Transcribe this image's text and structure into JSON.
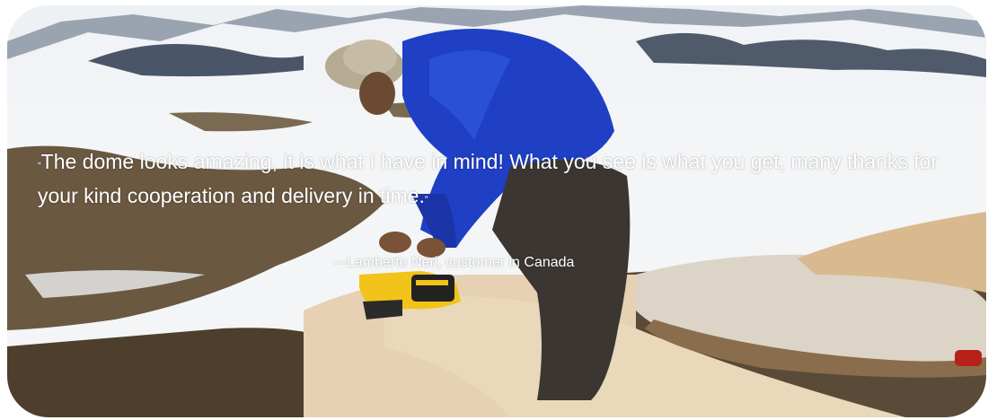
{
  "testimonial": {
    "quote_open": "“",
    "quote_text": "The dome looks amazing, it is what I have in mind! What you see is what you get, many thanks for your kind cooperation and delivery in time.",
    "quote_close": "”",
    "attribution": "---Lamberto Neri, customer in Canada"
  },
  "photo": {
    "description_icon": "photo-worker-sanding-dome-panel"
  },
  "colors": {
    "text": "#ffffff",
    "jacket": "#1f3fc4",
    "snow": "#f4f6f8",
    "tundra": "#5b4a36",
    "panel": "#e4cfae"
  }
}
